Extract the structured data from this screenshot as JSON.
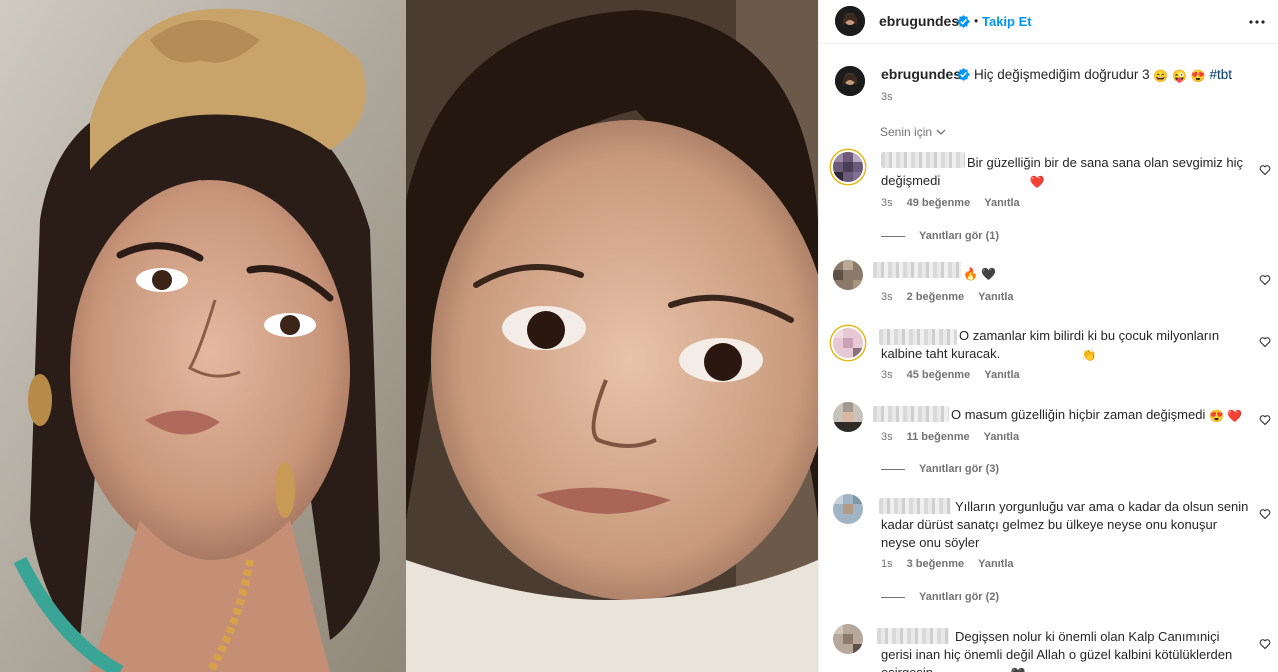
{
  "post": {
    "username": "ebrugundes",
    "follow_label": "Takip Et",
    "separator": "•",
    "caption_user": "ebrugundes",
    "caption": "Hiç değişmediğim doğrudur 3",
    "caption_emojis": [
      "😄",
      "😜",
      "😍"
    ],
    "hashtag": "#tbt",
    "caption_time": "3s",
    "filter_label": "Senin için"
  },
  "comments": [
    {
      "text": "Bir güzelliğin bir de sana sana olan sevgimiz hiç değişmedi",
      "emoji": "❤️",
      "time": "3s",
      "likes": "49 beğenme",
      "reply": "Yanıtla",
      "view_replies": "Yanıtları gör (1)"
    },
    {
      "text": "",
      "emoji": "🔥 🖤",
      "time": "3s",
      "likes": "2 beğenme",
      "reply": "Yanıtla",
      "view_replies": ""
    },
    {
      "text": "O zamanlar kim bilirdi ki bu çocuk milyonların kalbine taht kuracak.",
      "emoji": "👏",
      "time": "3s",
      "likes": "45 beğenme",
      "reply": "Yanıtla",
      "view_replies": ""
    },
    {
      "text": "O masum güzelliğin hiçbir zaman değişmedi",
      "emoji": "😍 ❤️",
      "time": "3s",
      "likes": "11 beğenme",
      "reply": "Yanıtla",
      "view_replies": "Yanıtları gör (3)"
    },
    {
      "text": "Yılların yorgunluğu var ama o kadar da olsun senin kadar dürüst sanatçı gelmez bu ülkeye neyse onu konuşur neyse onu söyler",
      "emoji": "",
      "time": "1s",
      "likes": "3 beğenme",
      "reply": "Yanıtla",
      "view_replies": "Yanıtları gör (2)"
    },
    {
      "text": "Degişsen nolur ki önemli olan Kalp Canımıniçi gerisi inan hiç önemli değil Allah o güzel kalbini kötülüklerden esirgesin",
      "emoji": "🖤",
      "time": "",
      "likes": "",
      "reply": "",
      "view_replies": ""
    }
  ],
  "colors": {
    "accent": "#0095f6",
    "text": "#262626",
    "muted": "#737373",
    "heart_red": "#ed4956"
  }
}
